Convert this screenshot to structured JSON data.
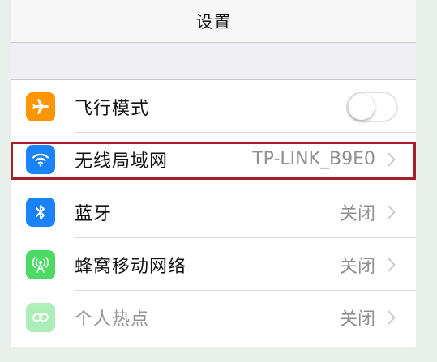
{
  "nav": {
    "title": "设置"
  },
  "rows": [
    {
      "label": "飞行模式",
      "value": "",
      "toggle_on": false,
      "icon": "airplane-icon",
      "icon_color": "#ff9500"
    },
    {
      "label": "无线局域网",
      "value": "TP-LINK_B9E0",
      "icon": "wifi-icon",
      "icon_color": "#1a82fb"
    },
    {
      "label": "蓝牙",
      "value": "关闭",
      "icon": "bluetooth-icon",
      "icon_color": "#1a82fb"
    },
    {
      "label": "蜂窝移动网络",
      "value": "关闭",
      "icon": "cellular-antenna-icon",
      "icon_color": "#4cd964"
    },
    {
      "label": "个人热点",
      "value": "关闭",
      "icon": "personal-hotspot-icon",
      "icon_color": "#4cd964",
      "disabled": true
    }
  ],
  "colors": {
    "highlight_border": "#a3202b",
    "chevron": "#c7c7cc"
  }
}
